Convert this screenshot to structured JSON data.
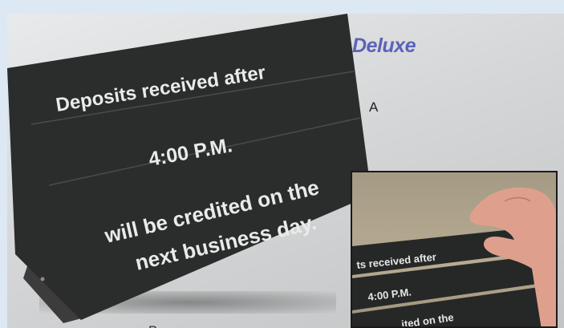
{
  "heading": "Deluxe",
  "label_a": "A",
  "label_b": "B",
  "sign": {
    "line1": "Deposits received after",
    "line2": "4:00 P.M.",
    "line3": "will be credited on the",
    "line4": "next business day."
  },
  "inset": {
    "strip1": "ts received after",
    "strip2": "4:00 P.M.",
    "strip3": "ited on the"
  },
  "colors": {
    "heading": "#5b63b8",
    "sign_face": "#2b2d2c",
    "background": "#dce8f3"
  }
}
